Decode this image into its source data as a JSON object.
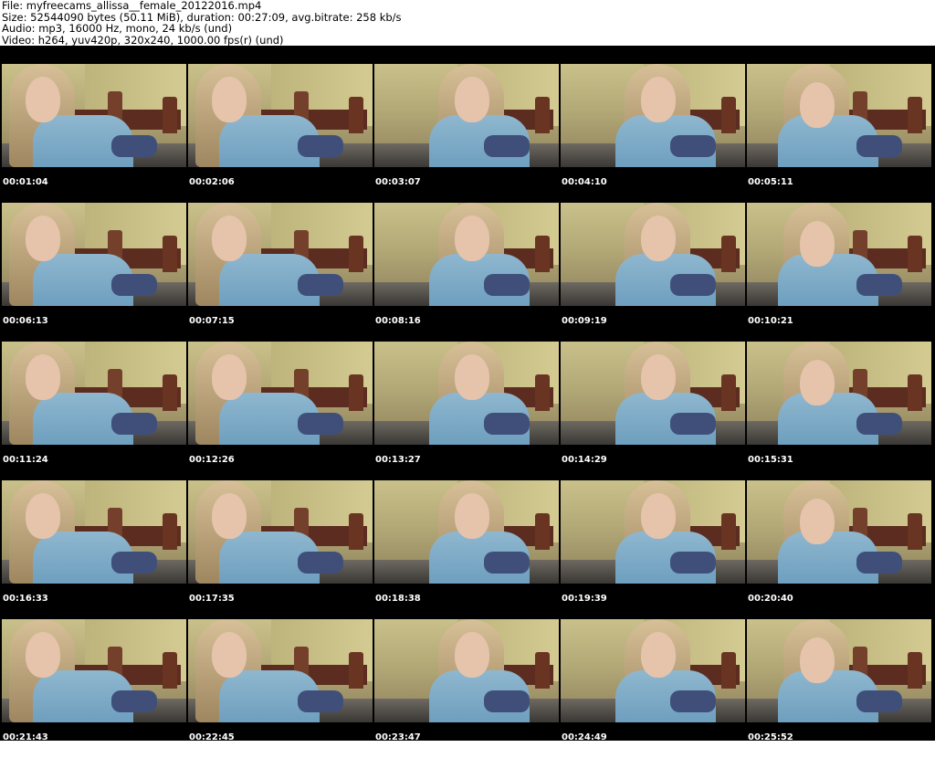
{
  "header": {
    "file_line": "File: myfreecams_allissa__female_20122016.mp4",
    "size_line": "Size: 52544090 bytes (50.11 MiB), duration: 00:27:09, avg.bitrate: 258 kb/s",
    "audio_line": "Audio: mp3, 16000 Hz, mono, 24 kb/s (und)",
    "video_line": "Video: h264, yuv420p, 320x240, 1000.00 fps(r) (und)"
  },
  "thumbnails": [
    {
      "timestamp": "00:01:04"
    },
    {
      "timestamp": "00:02:06"
    },
    {
      "timestamp": "00:03:07"
    },
    {
      "timestamp": "00:04:10"
    },
    {
      "timestamp": "00:05:11"
    },
    {
      "timestamp": "00:06:13"
    },
    {
      "timestamp": "00:07:15"
    },
    {
      "timestamp": "00:08:16"
    },
    {
      "timestamp": "00:09:19"
    },
    {
      "timestamp": "00:10:21"
    },
    {
      "timestamp": "00:11:24"
    },
    {
      "timestamp": "00:12:26"
    },
    {
      "timestamp": "00:13:27"
    },
    {
      "timestamp": "00:14:29"
    },
    {
      "timestamp": "00:15:31"
    },
    {
      "timestamp": "00:16:33"
    },
    {
      "timestamp": "00:17:35"
    },
    {
      "timestamp": "00:18:38"
    },
    {
      "timestamp": "00:19:39"
    },
    {
      "timestamp": "00:20:40"
    },
    {
      "timestamp": "00:21:43"
    },
    {
      "timestamp": "00:22:45"
    },
    {
      "timestamp": "00:23:47"
    },
    {
      "timestamp": "00:24:49"
    },
    {
      "timestamp": "00:25:52"
    }
  ]
}
